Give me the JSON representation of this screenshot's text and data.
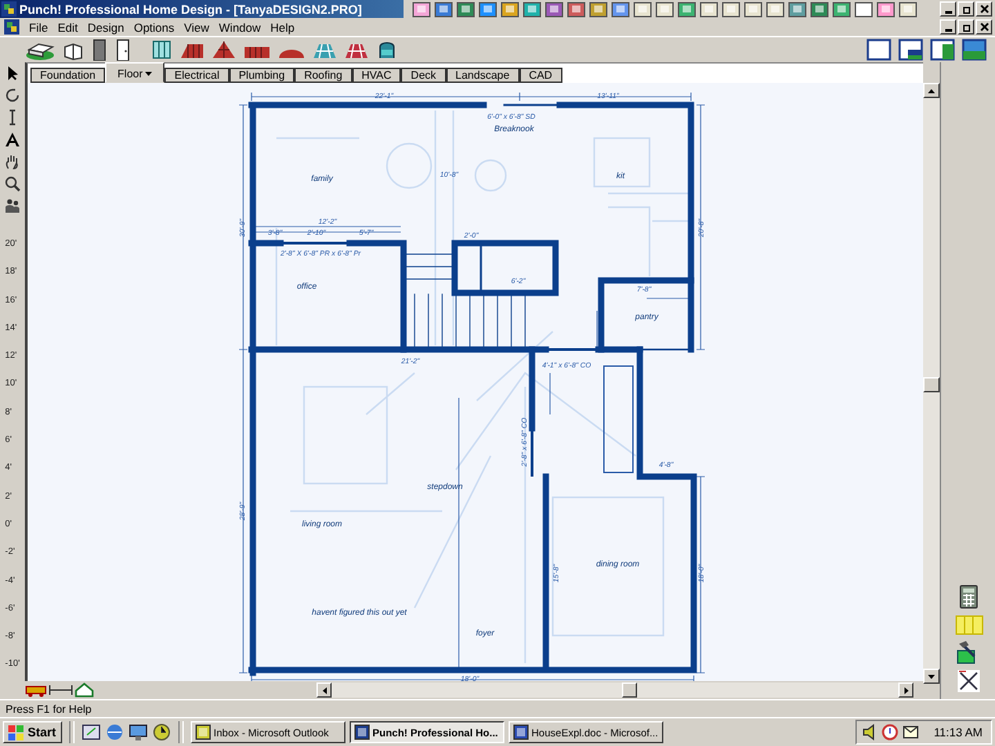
{
  "window": {
    "title": "Punch! Professional Home Design - [TanyaDESIGN2.PRO]"
  },
  "menu": [
    "File",
    "Edit",
    "Design",
    "Options",
    "View",
    "Window",
    "Help"
  ],
  "tabs": [
    {
      "label": "Foundation",
      "selected": false,
      "has_menu": false
    },
    {
      "label": "Floor",
      "selected": true,
      "has_menu": true
    },
    {
      "label": "Electrical",
      "selected": false,
      "has_menu": false
    },
    {
      "label": "Plumbing",
      "selected": false,
      "has_menu": false
    },
    {
      "label": "Roofing",
      "selected": false,
      "has_menu": false
    },
    {
      "label": "HVAC",
      "selected": false,
      "has_menu": false
    },
    {
      "label": "Deck",
      "selected": false,
      "has_menu": false
    },
    {
      "label": "Landscape",
      "selected": false,
      "has_menu": false
    },
    {
      "label": "CAD",
      "selected": false,
      "has_menu": false
    }
  ],
  "ruler": [
    "20'",
    "18'",
    "16'",
    "14'",
    "12'",
    "10'",
    "8'",
    "6'",
    "4'",
    "2'",
    "0'",
    "-2'",
    "-4'",
    "-6'",
    "-8'",
    "-10'"
  ],
  "plan": {
    "labels": [
      {
        "kind": "dimension",
        "text": "22'-1\""
      },
      {
        "kind": "dimension",
        "text": "13'-11\""
      },
      {
        "kind": "dimension",
        "text": "6'-0\" x 6'-8\" SD"
      },
      {
        "kind": "room",
        "text": "Breaknook"
      },
      {
        "kind": "room",
        "text": "family"
      },
      {
        "kind": "dimension",
        "text": "10'-8\""
      },
      {
        "kind": "room",
        "text": "kit"
      },
      {
        "kind": "dimension",
        "text": "12'-2\""
      },
      {
        "kind": "dimension",
        "text": "3'-8\""
      },
      {
        "kind": "dimension",
        "text": "2'-10\""
      },
      {
        "kind": "dimension",
        "text": "5'-7\""
      },
      {
        "kind": "dimension",
        "text": "2'-8\" X 6'-8\" PR  x 6'-8\" Pr"
      },
      {
        "kind": "room",
        "text": "office"
      },
      {
        "kind": "dimension",
        "text": "2'-0\""
      },
      {
        "kind": "dimension",
        "text": "6'-2\""
      },
      {
        "kind": "dimension",
        "text": "7'-8\""
      },
      {
        "kind": "room",
        "text": "pantry"
      },
      {
        "kind": "dimension",
        "text": "21'-2\""
      },
      {
        "kind": "dimension",
        "text": "4'-1\" x 6'-8\" CO"
      },
      {
        "kind": "room",
        "text": "stepdown"
      },
      {
        "kind": "room",
        "text": "living room"
      },
      {
        "kind": "room",
        "text": "dining room"
      },
      {
        "kind": "room",
        "text": "havent figured this out yet"
      },
      {
        "kind": "room",
        "text": "foyer"
      },
      {
        "kind": "dimension",
        "text": "18'-0\""
      },
      {
        "kind": "dimension",
        "text": "4'-8\""
      },
      {
        "kind": "dimension",
        "text": "28'-9\""
      },
      {
        "kind": "dimension",
        "text": "15'-8\""
      },
      {
        "kind": "dimension",
        "text": "18'-0\""
      },
      {
        "kind": "dimension",
        "text": "2'-8\" x 6'-8\" CO"
      },
      {
        "kind": "dimension",
        "text": "20'-8\""
      },
      {
        "kind": "dimension",
        "text": "30'-9\""
      }
    ]
  },
  "status_bar": "Press F1 for Help",
  "taskbar": {
    "start": "Start",
    "tasks": [
      {
        "label": "Inbox - Microsoft Outlook",
        "selected": false
      },
      {
        "label": "Punch! Professional Ho...",
        "selected": true
      },
      {
        "label": "HouseExpl.doc - Microsof...",
        "selected": false
      }
    ],
    "clock": "11:13 AM"
  }
}
